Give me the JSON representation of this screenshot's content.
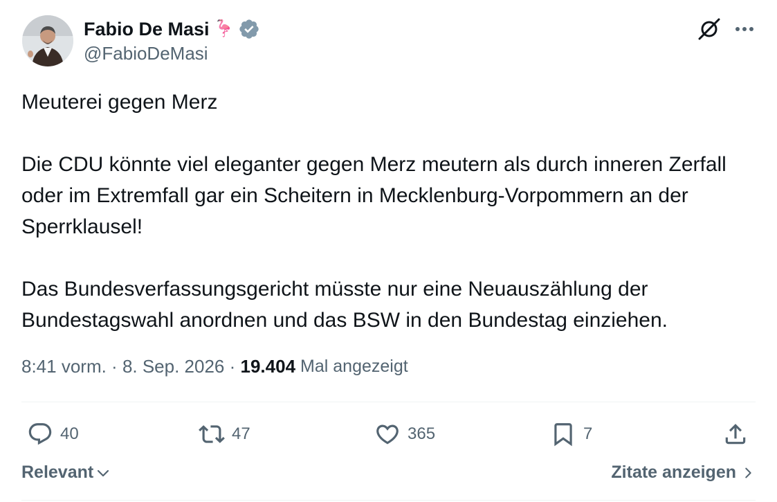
{
  "author": {
    "name": "Fabio De Masi",
    "emoji": "🦩",
    "handle": "@FabioDeMasi"
  },
  "tweet": {
    "text": "Meuterei gegen Merz\n\nDie CDU könnte viel eleganter gegen Merz meutern als durch inneren Zerfall oder im Extremfall gar ein Scheitern in Mecklenburg-Vorpommern an der Sperrklausel!\n\nDas Bundesverfassungsgericht müsste nur eine Neuauszählung der Bundestagswahl anordnen und das BSW in den Bundestag einziehen."
  },
  "meta": {
    "time": "8:41 vorm.",
    "sep1": " · ",
    "date": "8. Sep. 2026",
    "sep2": " · ",
    "views_count": "19.404",
    "views_label": "Mal angezeigt"
  },
  "actions": {
    "replies": "40",
    "reposts": "47",
    "likes": "365",
    "bookmarks": "7"
  },
  "bottom": {
    "sort_label": "Relevant",
    "quotes_label": "Zitate anzeigen"
  },
  "colors": {
    "text_primary": "#0f1419",
    "text_secondary": "#536471",
    "verified": "#829aab",
    "divider": "#eff3f4"
  },
  "icons": [
    "grok-icon",
    "more-icon",
    "verified-badge-icon",
    "reply-icon",
    "repost-icon",
    "like-icon",
    "bookmark-icon",
    "share-icon",
    "chevron-down-icon",
    "chevron-right-icon"
  ]
}
